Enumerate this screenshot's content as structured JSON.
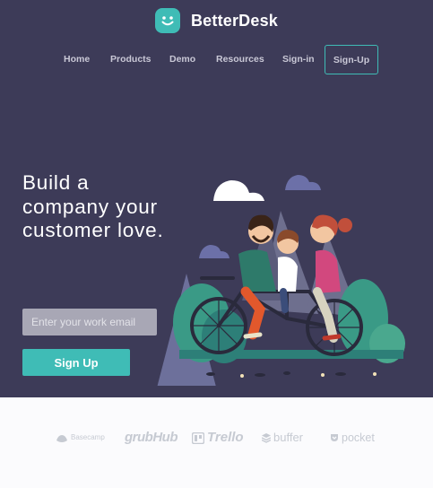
{
  "brand": {
    "name": "BetterDesk",
    "logo_icon": "smiley-icon",
    "accent": "#3fbcb6"
  },
  "nav": {
    "items": [
      {
        "label": "Home"
      },
      {
        "label": "Products"
      },
      {
        "label": "Demo"
      },
      {
        "label": "Resources"
      },
      {
        "label": "Sign-in"
      },
      {
        "label": "Sign-Up"
      }
    ]
  },
  "hero": {
    "headline": "Build a company your customer love.",
    "email_placeholder": "Enter your work email",
    "signup_label": "Sign Up",
    "background": "#3d3b58"
  },
  "partners": {
    "items": [
      {
        "name": "Basecamp",
        "icon": "basecamp-icon"
      },
      {
        "name": "grubHub"
      },
      {
        "name": "Trello",
        "icon": "trello-icon"
      },
      {
        "name": "buffer",
        "icon": "buffer-icon"
      },
      {
        "name": "pocket",
        "icon": "pocket-icon"
      }
    ]
  }
}
